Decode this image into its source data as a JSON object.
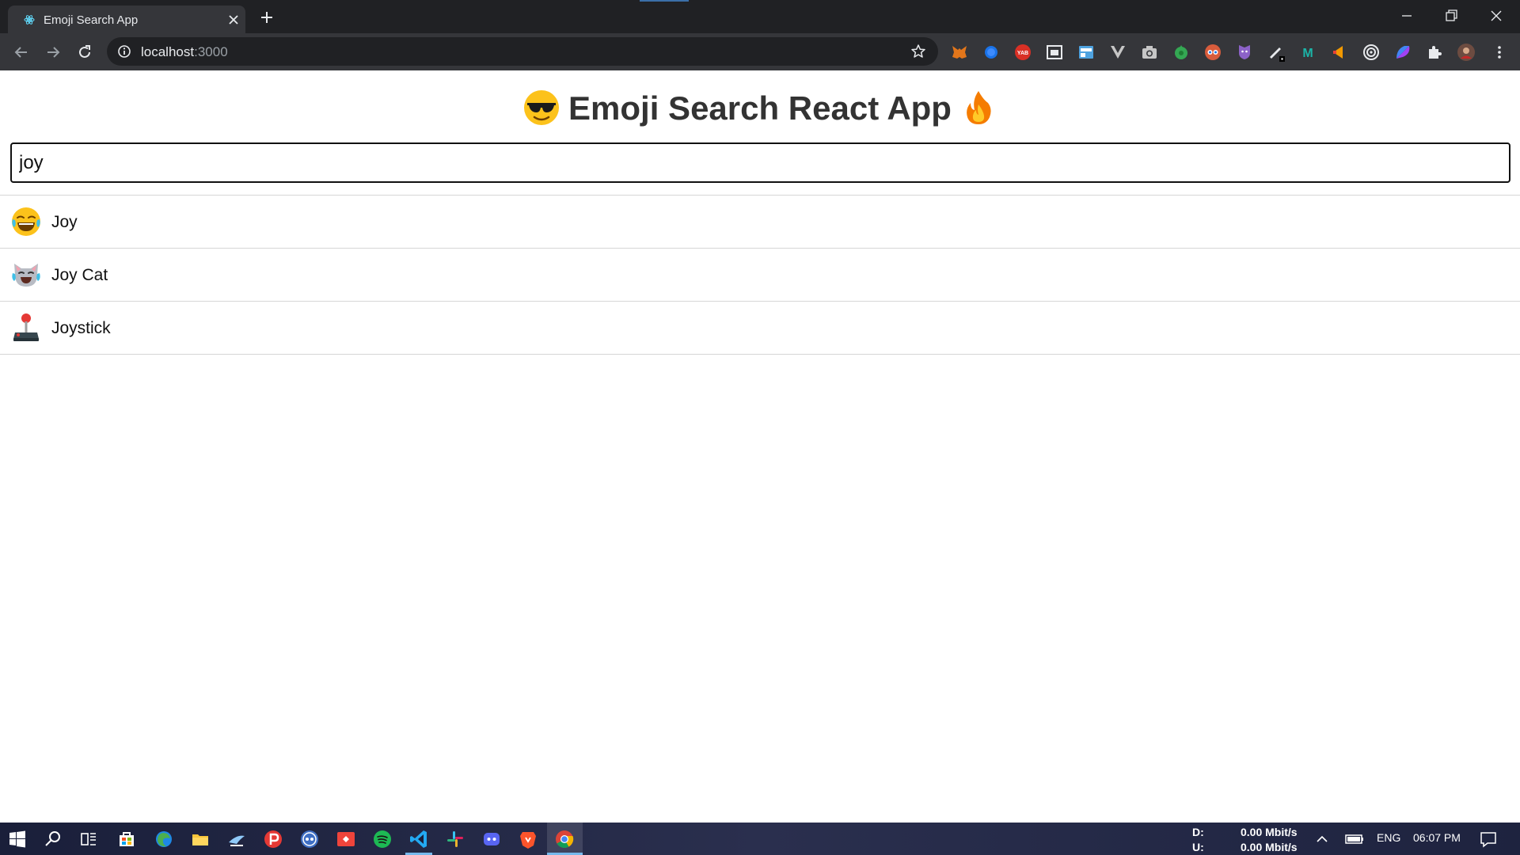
{
  "browser": {
    "tab_title": "Emoji Search App",
    "url_host": "localhost",
    "url_port": ":3000"
  },
  "extensions": [
    "metamask-icon",
    "blue-dot-icon",
    "yab-icon",
    "window-icon",
    "screen-icon",
    "vue-icon",
    "camera-icon",
    "green-icon",
    "glasses-icon",
    "shield-icon",
    "pen-icon",
    "m-icon",
    "orange-icon",
    "target-icon",
    "purple-icon",
    "puzzle-icon",
    "avatar"
  ],
  "extension_yab_label": "YAB",
  "extension_m_label": "M",
  "app": {
    "title": "Emoji Search React App",
    "title_emoji_left": "sunglasses-face",
    "title_emoji_right": "fire"
  },
  "search": {
    "value": "joy",
    "placeholder": ""
  },
  "results": [
    {
      "emoji": "joy-face",
      "label": "Joy"
    },
    {
      "emoji": "joy-cat",
      "label": "Joy Cat"
    },
    {
      "emoji": "joystick",
      "label": "Joystick"
    }
  ],
  "taskbar": {
    "net_down_label": "D:",
    "net_down_value": "0.00 Mbit/s",
    "net_up_label": "U:",
    "net_up_value": "0.00 Mbit/s",
    "language": "ENG",
    "time": "06:07 PM"
  },
  "colors": {
    "chrome_dark": "#202124",
    "chrome_toolbar": "#35363a",
    "search_border": "#111111",
    "row_divider": "#d6d6d6",
    "taskbar_accent": "#76b9ed"
  }
}
